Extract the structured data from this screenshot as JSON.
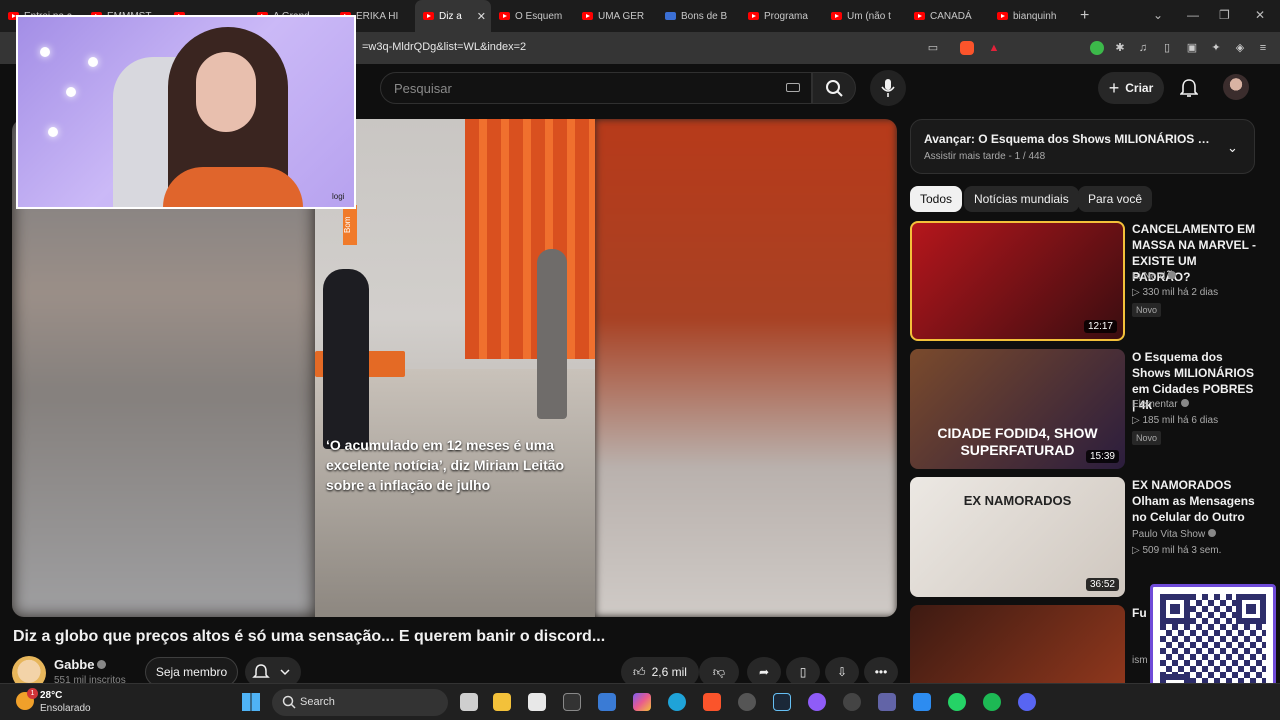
{
  "browser": {
    "tabs": [
      {
        "label": "Entrei na c",
        "kind": "yt"
      },
      {
        "label": "EMMMST",
        "kind": "yt"
      },
      {
        "label": "",
        "kind": "yt"
      },
      {
        "label": "A Grand",
        "kind": "yt"
      },
      {
        "label": "ERIKA HI",
        "kind": "yt"
      },
      {
        "label": "Diz a",
        "kind": "yt",
        "active": true
      },
      {
        "label": "O Esquem",
        "kind": "yt"
      },
      {
        "label": "UMA GER",
        "kind": "yt"
      },
      {
        "label": "Bons de B",
        "kind": "doc"
      },
      {
        "label": "Programa",
        "kind": "yt"
      },
      {
        "label": "Um (não t",
        "kind": "yt"
      },
      {
        "label": "CANADÁ",
        "kind": "yt"
      },
      {
        "label": "bianquinh",
        "kind": "yt"
      }
    ],
    "close_glyph": "✕",
    "new_tab": "+",
    "url_fragment": "=w3q-MldrQDg&list=WL&index=2"
  },
  "youtube": {
    "search_placeholder": "Pesquisar",
    "create_label": "Criar",
    "create_icon": "plus-icon"
  },
  "player": {
    "caption": "‘O acumulado em 12 meses é uma excelente notícia’, diz Miriam Leitão sobre a inflação de julho",
    "side_badge": "Bom",
    "webcam_brand": "logi"
  },
  "video": {
    "title": "Diz a globo que preços altos é só uma sensação... E querem banir o discord...",
    "channel": "Gabbe",
    "subscribers": "551 mil inscritos",
    "member_label": "Seja membro",
    "likes": "2,6 mil"
  },
  "queue": {
    "next_title": "Avançar: O Esquema dos Shows MILIONÁRIOS em Ci...",
    "sub": "Assistir mais tarde - 1 / 448"
  },
  "chips": [
    "Todos",
    "Notícias mundiais",
    "Para você"
  ],
  "recommendations": [
    {
      "title": "CANCELAMENTO EM MASSA NA MARVEL - EXISTE UM PADRÃO?",
      "channel": "Ei Nerd",
      "meta": "▷ 330 mil   há 2 dias",
      "badge": "Novo",
      "duration": "12:17",
      "thumb_text": "",
      "color_a": "#b5161c",
      "color_b": "#3a0d10"
    },
    {
      "title": "O Esquema dos Shows MILIONÁRIOS em Cidades POBRES | 4k",
      "channel": "Elementar",
      "meta": "▷ 185 mil   há 6 dias",
      "badge": "Novo",
      "duration": "15:39",
      "thumb_text": "CIDADE FODID4, SHOW SUPERFATURAD",
      "color_a": "#7a4a2c",
      "color_b": "#2b1d3d"
    },
    {
      "title": "EX NAMORADOS Olham as Mensagens no Celular do Outro",
      "channel": "Paulo Vita Show",
      "meta": "▷ 509 mil   há 3 sem.",
      "badge": "",
      "duration": "36:52",
      "thumb_text": "EX NAMORADOS",
      "color_a": "#ece8e3",
      "color_b": "#cfc7bf"
    },
    {
      "title": "Fu de am",
      "channel": "ism",
      "meta": "",
      "badge": "",
      "duration": "",
      "thumb_text": "",
      "color_a": "#3d1a12",
      "color_b": "#9a3b1e"
    }
  ],
  "taskbar": {
    "temp": "28°C",
    "condition": "Ensolarado",
    "alert_count": "1",
    "search_label": "Search"
  }
}
